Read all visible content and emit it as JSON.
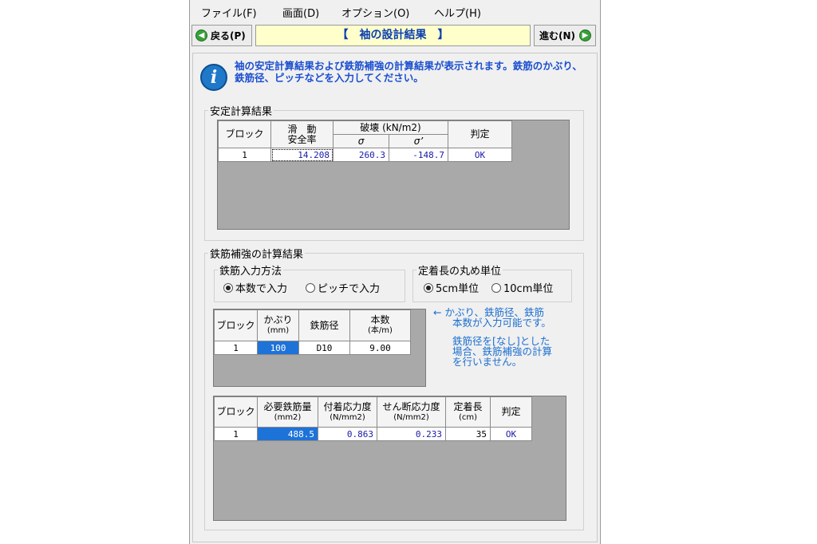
{
  "menu": [
    "ファイル(F)",
    "画面(D)",
    "オプション(O)",
    "ヘルプ(H)"
  ],
  "nav": {
    "back_label": "戻る(P)",
    "title": "【　袖の設計結果　】",
    "next_label": "進む(N)"
  },
  "info_text": "袖の安定計算結果および鉄筋補強の計算結果が表示されます。鉄筋のかぶり、鉄筋径、ピッチなどを入力してください。",
  "stability": {
    "legend": "安定計算結果",
    "headers": {
      "block": "ブロック",
      "sliding_1": "滑　動",
      "sliding_2": "安全率",
      "failure": "破壊 (kN/m2)",
      "sigma": "σ",
      "sigma_prime": "σ’",
      "judge": "判定"
    },
    "rows": [
      {
        "block": "1",
        "sliding": "14.208",
        "sigma": "260.3",
        "sigma_prime": "-148.7",
        "judge": "OK"
      }
    ]
  },
  "rebar": {
    "legend": "鉄筋補強の計算結果",
    "input_method": {
      "legend": "鉄筋入力方法",
      "options": [
        "本数で入力",
        "ピッチで入力"
      ],
      "selected": 0
    },
    "rounding": {
      "legend": "定着長の丸め単位",
      "options": [
        "5cm単位",
        "10cm単位"
      ],
      "selected": 0
    },
    "input_table": {
      "headers": {
        "block": "ブロック",
        "cover_1": "かぶり",
        "cover_2": "(mm)",
        "dia": "鉄筋径",
        "count_1": "本数",
        "count_2": "(本/m)"
      },
      "rows": [
        {
          "block": "1",
          "cover": "100",
          "dia": "D10",
          "count": "9.00"
        }
      ]
    },
    "note": {
      "line1": "← かぶり、鉄筋径、鉄筋",
      "line2": "本数が入力可能です。",
      "line3": "鉄筋径を[なし]とした",
      "line4": "場合、鉄筋補強の計算",
      "line5": "を行いません。"
    },
    "result_table": {
      "headers": {
        "block": "ブロック",
        "req_1": "必要鉄筋量",
        "req_2": "(mm2)",
        "bond_1": "付着応力度",
        "bond_2": "(N/mm2)",
        "shear_1": "せん断応力度",
        "shear_2": "(N/mm2)",
        "anchor_1": "定着長",
        "anchor_2": "(cm)",
        "judge": "判定"
      },
      "rows": [
        {
          "block": "1",
          "req": "488.5",
          "bond": "0.863",
          "shear": "0.233",
          "anchor": "35",
          "judge": "OK"
        }
      ]
    }
  }
}
